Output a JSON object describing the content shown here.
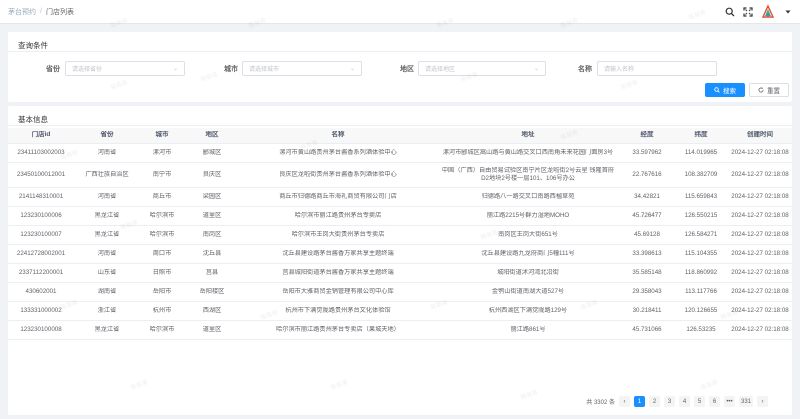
{
  "breadcrumb": {
    "parent": "茅台预约",
    "separator": "/",
    "current": "门店列表"
  },
  "query": {
    "title": "查询条件",
    "province_label": "省份",
    "province_placeholder": "请选择省份",
    "city_label": "城市",
    "city_placeholder": "请选择城市",
    "district_label": "地区",
    "district_placeholder": "请选择地区",
    "name_label": "名称",
    "name_placeholder": "请输入名称",
    "search_label": "搜索",
    "reset_label": "重置"
  },
  "list": {
    "title": "基本信息",
    "columns": [
      "门店id",
      "省份",
      "城市",
      "地区",
      "名称",
      "地址",
      "经度",
      "纬度",
      "创建时间"
    ],
    "rows": [
      [
        "234111030​02003",
        "河南省",
        "漯河市",
        "郾城区",
        "漯河市黄山路贵州茅台酱香系列酒体验中心",
        "漯河市郾城区嵩山路与黄山路交叉口西南角未来花园门面房3号",
        "33.597962",
        "114.019965",
        "2024-12-27 02:18:08"
      ],
      [
        "23450100012001",
        "广西壮族自治区",
        "南宁市",
        "良庆区",
        "良庆区龙啦街贵州茅台酱香系列酒体验中心",
        "中国（广西）自由贸易试验区南宁片区龙啦街2号云星 钱隆首府D2地块2号楼一层101、106号办公",
        "22.767616",
        "108.382709",
        "2024-12-27 02:18:08"
      ],
      [
        "2141148310001",
        "河南省",
        "商丘市",
        "梁园区",
        "商丘市归德路商丘市海礼商贸有限公司门店",
        "归德路八一路交叉口南路西楹草苑",
        "34.42821",
        "115.659843",
        "2024-12-27 02:18:08"
      ],
      [
        "123230100006",
        "黑龙江省",
        "哈尔滨市",
        "道里区",
        "哈尔滨市丽江路贵州茅台专卖店",
        "丽江路2215号群力湿地MOHO",
        "45.726477",
        "126.550215",
        "2024-12-27 02:18:08"
      ],
      [
        "123230100007",
        "黑龙江省",
        "哈尔滨市",
        "南岗区",
        "哈尔滨市王岗大街贵州茅台专卖店",
        "南岗区王岗大街651号",
        "45.69128",
        "126.584271",
        "2024-12-27 02:18:08"
      ],
      [
        "22412728002001",
        "河南省",
        "周口市",
        "沈丘县",
        "沈丘县建设路茅台酱香万家共享主题终端",
        "沈丘县建设路九龙府商门5幢111号",
        "33.398613",
        "115.104355",
        "2024-12-27 02:18:08"
      ],
      [
        "2337112200001",
        "山东省",
        "日照市",
        "莒县",
        "莒县城阳街道茅台酱香万家共享主题终端",
        "城阳街道沭河湾北沿街",
        "35.585148",
        "118.860992",
        "2024-12-27 02:18:08"
      ],
      [
        "430602001",
        "湖南省",
        "岳阳市",
        "岳阳楼区",
        "岳阳市大雅商贸金销管理有限公司中心库",
        "金鹗山街道南湖大道527号",
        "29.358043",
        "113.117766",
        "2024-12-27 02:18:08"
      ],
      [
        "133331000002",
        "浙江省",
        "杭州市",
        "西湖区",
        "杭州市下满觉陇路贵州茅台文化体验馆",
        "杭州西湖区下满觉陇路129号",
        "30.218411",
        "120.126655",
        "2024-12-27 02:18:08"
      ],
      [
        "123230100008",
        "黑龙江省",
        "哈尔滨市",
        "道里区",
        "哈尔滨市丽江路贵州茅台专卖店（果城天地）",
        "丽江路861号",
        "45.731066",
        "126.53235",
        "2024-12-27 02:18:08"
      ]
    ]
  },
  "pagination": {
    "total": "共 3302 条",
    "prev": "‹",
    "pages": [
      "1",
      "2",
      "3",
      "4",
      "5",
      "6"
    ],
    "ellipsis": "•••",
    "last": "331",
    "next": "›",
    "current": "1"
  },
  "watermark": "蒋蒋蒋",
  "colors": {
    "primary": "#1890ff",
    "header_bg": "#f8f8f9",
    "page_bg": "#f0f2f5"
  }
}
